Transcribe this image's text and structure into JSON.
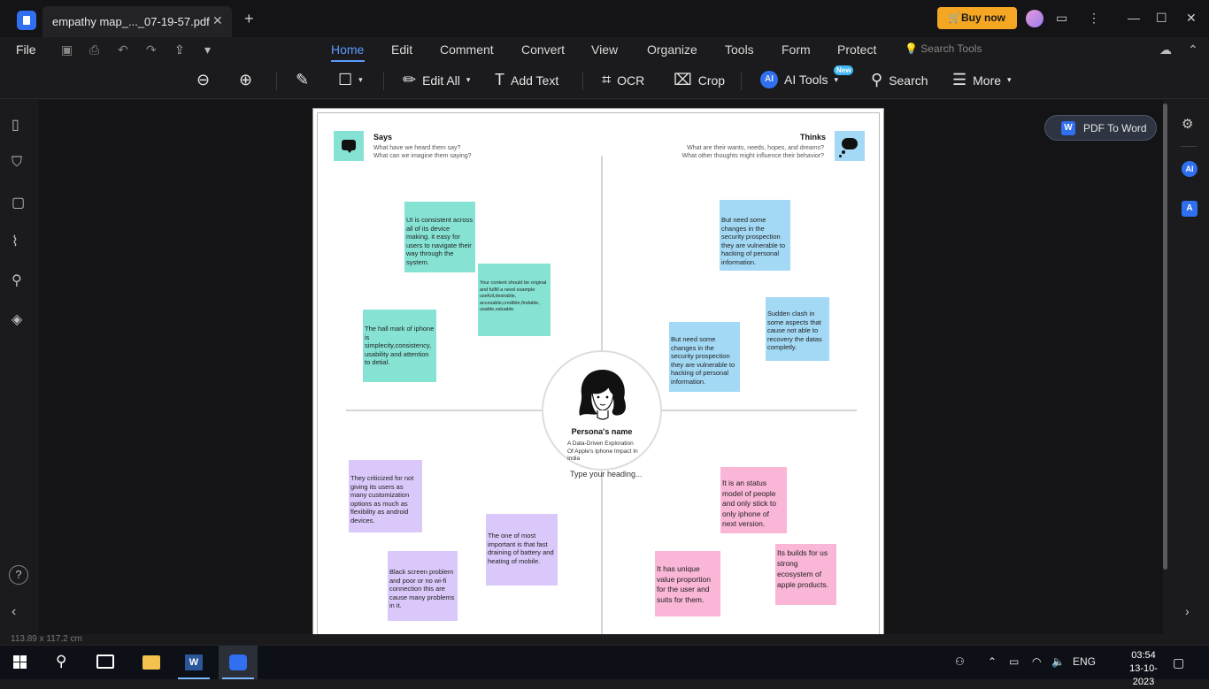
{
  "titlebar": {
    "tab_title": "empathy  map_..._07-19-57.pdf",
    "tab_close": "✕",
    "new_tab": "+",
    "buy_now": "Buy now"
  },
  "menu": {
    "file": "File",
    "tabs": [
      "Home",
      "Edit",
      "Comment",
      "Convert",
      "View",
      "Organize",
      "Tools",
      "Form",
      "Protect"
    ],
    "search_tools": "Search Tools"
  },
  "toolbar": {
    "edit_all": "Edit All",
    "add_text": "Add Text",
    "ocr": "OCR",
    "crop": "Crop",
    "ai_tools": "AI Tools",
    "new_badge": "New",
    "search": "Search",
    "more": "More"
  },
  "right_panel": {
    "pdf_to_word": "PDF To Word"
  },
  "empathy_map": {
    "says": {
      "title": "Says",
      "sub1": "What have we heard them say?",
      "sub2": "What can we imagine them saying?"
    },
    "thinks": {
      "title": "Thinks",
      "sub1": "What are their wants, needs, hopes, and dreams?",
      "sub2": "What other thoughts might influence their behavior?"
    },
    "notes": {
      "says1": "UI is consistent across all of its device making. it easy for users to navigate their way through the system.",
      "says2": "Your content should be original and fulfill a need example usefull,desirable, accesable,credible,findable, usable,valuable.",
      "says3": "The hall mark of iphone is simplecity,consistency, usability and attention to detial.",
      "thinks1": "But need some changes in the security prospection they are vulnerable to hacking of personal information.",
      "thinks2": "Sudden clash in some aspects that cause not able to recovery the datas completly.",
      "thinks3": "But need some changes in the security prospection they are vulnerable to hacking of personal information.",
      "does1": "They criticized for not giving its users as many customization options as much as flexibility as android devices.",
      "does2": "The one of most important is that fast draining of battery and heating of  mobile.",
      "does3": "Black screen problem and poor or no wi-fi connection this are cause many problems in it.",
      "feels1": "It is an status model of people and only stick to only iphone of next version.",
      "feels2": "Its builds for us strong ecosystem of apple products.",
      "feels3": "It has unique value proportion for the user and suits for them."
    },
    "persona": {
      "name": "Persona's name",
      "desc": "A Data-Driven Exploration Of Apple's Iphone Impact In India",
      "heading": "Type your heading..."
    }
  },
  "status": {
    "page_dims": "113.89 x 117.2 cm"
  },
  "taskbar": {
    "lang": "ENG",
    "time": "03:54",
    "date": "13-10-2023"
  },
  "colors": {
    "accent": "#5b9bff",
    "buy_now": "#f5a623",
    "note_green": "#86e3d3",
    "note_blue": "#a3d9f5",
    "note_purple": "#d9c8f9",
    "note_pink": "#f9b6d6"
  }
}
